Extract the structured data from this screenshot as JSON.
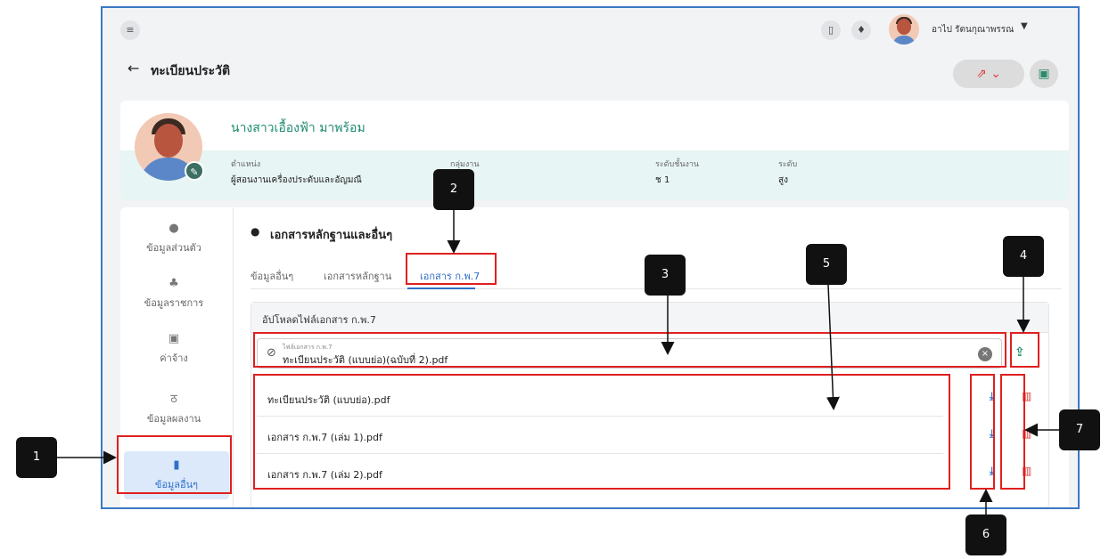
{
  "topbar": {
    "username": "อาไป รัตนกุณาพรรณ",
    "icons": [
      "menu-icon",
      "book-icon",
      "bell-icon"
    ]
  },
  "page": {
    "title": "ทะเบียนประวัติ"
  },
  "profile": {
    "name": "นางสาวเอื้องฟ้า มาพร้อม",
    "fields": [
      {
        "label": "ตำแหน่ง",
        "value": "ผู้สอนงานเครื่องประดับและอัญมณี"
      },
      {
        "label": "กลุ่มงาน",
        "value": ""
      },
      {
        "label": "ระดับชั้นงาน",
        "value": "ช 1"
      },
      {
        "label": "ระดับ",
        "value": "สูง"
      }
    ]
  },
  "sidebar": {
    "items": [
      {
        "label": "ข้อมูลส่วนตัว",
        "icon": "person-icon"
      },
      {
        "label": "ข้อมูลราชการ",
        "icon": "org-icon"
      },
      {
        "label": "ค่าจ้าง",
        "icon": "money-icon"
      },
      {
        "label": "ข้อมูลผลงาน",
        "icon": "medal-icon"
      },
      {
        "label": "ข้อมูลอื่นๆ",
        "icon": "bookmark-icon",
        "active": true
      }
    ]
  },
  "section": {
    "title": "เอกสารหลักฐานและอื่นๆ"
  },
  "tabs": [
    {
      "label": "ข้อมูลอื่นๆ"
    },
    {
      "label": "เอกสารหลักฐาน"
    },
    {
      "label": "เอกสาร ก.พ.7",
      "active": true
    }
  ],
  "upload": {
    "header": "อัปโหลดไฟล์เอกสาร ก.พ.7",
    "input_label": "ไฟล์เอกสาร ก.พ.7",
    "input_value": "ทะเบียนประวัติ (แบบย่อ)(ฉบับที่ 2).pdf"
  },
  "files": [
    {
      "name": "ทะเบียนประวัติ (แบบย่อ).pdf"
    },
    {
      "name": "เอกสาร ก.พ.7 (เล่ม 1).pdf"
    },
    {
      "name": "เอกสาร ก.พ.7 (เล่ม 2).pdf"
    }
  ],
  "callouts": [
    "1",
    "2",
    "3",
    "4",
    "5",
    "6",
    "7"
  ],
  "colors": {
    "accent": "#2f6fc6",
    "brand": "#1e8b6f",
    "annotation": "#e02020",
    "danger": "#d83a3a"
  }
}
